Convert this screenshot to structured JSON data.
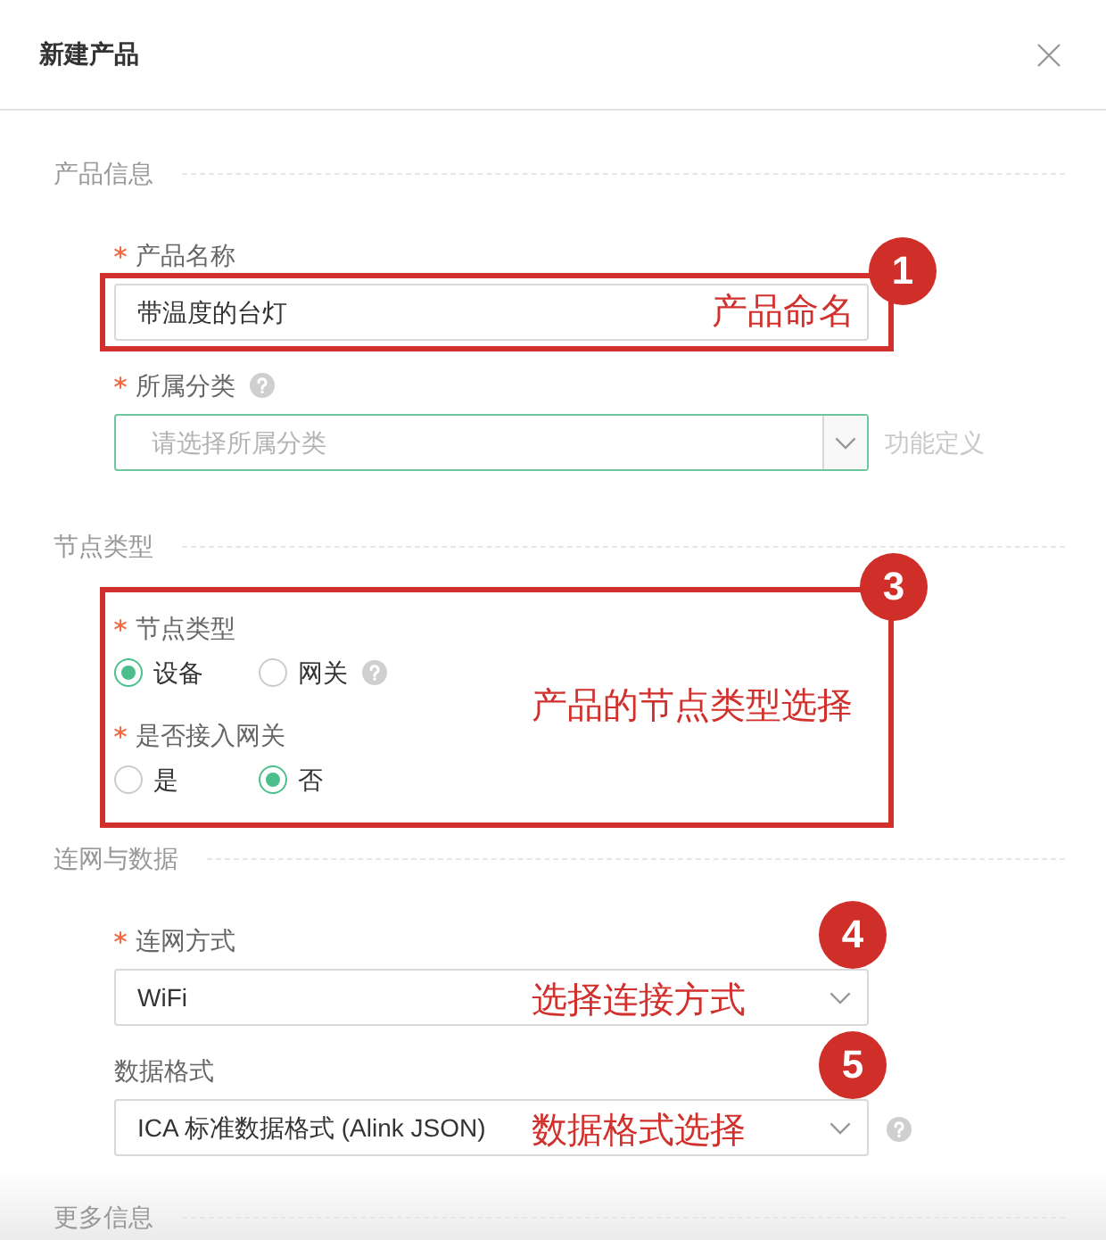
{
  "dialog": {
    "title": "新建产品"
  },
  "sections": [
    {
      "title": "产品信息",
      "fields": [
        {
          "kind": "text",
          "label": "产品名称",
          "required": true,
          "value": "带温度的台灯",
          "annotation": {
            "number": "1",
            "text": "产品命名",
            "boxed": true
          }
        },
        {
          "kind": "combobox",
          "label": "所属分类",
          "required": true,
          "help": true,
          "placeholder": "请选择所属分类",
          "focused": true,
          "side_link": {
            "label": "功能定义",
            "disabled": true
          }
        }
      ]
    },
    {
      "title": "节点类型",
      "annotation": {
        "number": "3",
        "text": "产品的节点类型选择",
        "boxed": true
      },
      "fields": [
        {
          "kind": "radio",
          "label": "节点类型",
          "required": true,
          "help": true,
          "options": [
            {
              "label": "设备",
              "selected": true
            },
            {
              "label": "网关",
              "selected": false
            }
          ]
        },
        {
          "kind": "radio",
          "label": "是否接入网关",
          "required": true,
          "options": [
            {
              "label": "是",
              "selected": false
            },
            {
              "label": "否",
              "selected": true
            }
          ]
        }
      ]
    },
    {
      "title": "连网与数据",
      "fields": [
        {
          "kind": "select",
          "label": "连网方式",
          "required": true,
          "value": "WiFi",
          "focused": false,
          "annotation": {
            "number": "4",
            "text": "选择连接方式",
            "boxed": false
          }
        },
        {
          "kind": "select",
          "label": "数据格式",
          "required": false,
          "help": true,
          "value": "ICA 标准数据格式 (Alink JSON)",
          "focused": false,
          "annotation": {
            "number": "5",
            "text": "数据格式选择",
            "boxed": false
          }
        }
      ]
    },
    {
      "title": "更多信息"
    }
  ]
}
